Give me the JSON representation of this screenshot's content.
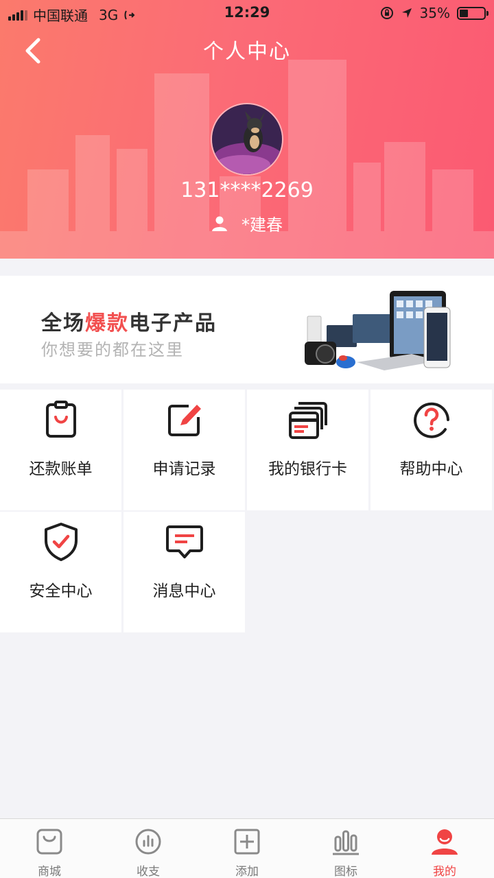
{
  "status_bar": {
    "carrier": "中国联通",
    "network": "3G",
    "time": "12:29",
    "battery": "35%",
    "battery_level": 0.35
  },
  "header": {
    "title": "个人中心",
    "phone": "131****2269",
    "name": "*建春"
  },
  "banner": {
    "title_pre": "全场",
    "title_highlight": "爆款",
    "title_post": "电子产品",
    "subtitle": "你想要的都在这里"
  },
  "menu": [
    {
      "label": "还款账单",
      "icon": "clipboard-icon"
    },
    {
      "label": "申请记录",
      "icon": "edit-icon"
    },
    {
      "label": "我的银行卡",
      "icon": "bank-card-icon"
    },
    {
      "label": "帮助中心",
      "icon": "help-icon"
    },
    {
      "label": "安全中心",
      "icon": "shield-icon"
    },
    {
      "label": "消息中心",
      "icon": "message-icon"
    }
  ],
  "tabs": [
    {
      "label": "商城",
      "icon": "shop-bag-icon"
    },
    {
      "label": "收支",
      "icon": "chart-circle-icon"
    },
    {
      "label": "添加",
      "icon": "add-icon"
    },
    {
      "label": "图标",
      "icon": "bar-chart-icon"
    },
    {
      "label": "我的",
      "icon": "user-icon",
      "active": true
    }
  ],
  "colors": {
    "accent": "#f04444",
    "header_gradient_start": "#fb7a6c",
    "header_gradient_end": "#fb5a72"
  }
}
